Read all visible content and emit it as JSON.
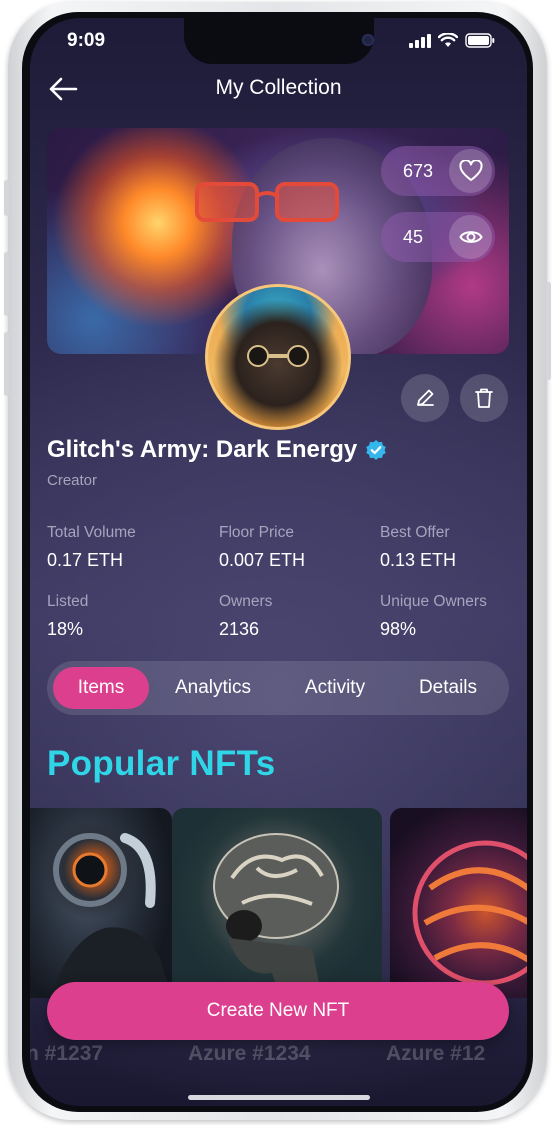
{
  "status_bar": {
    "time": "9:09"
  },
  "header": {
    "title": "My Collection"
  },
  "banner": {
    "likes": "673",
    "views": "45"
  },
  "collection": {
    "name": "Glitch's Army: Dark Energy",
    "role": "Creator",
    "verified": true
  },
  "stats": [
    {
      "label": "Total Volume",
      "value": "0.17 ETH"
    },
    {
      "label": "Floor Price",
      "value": "0.007 ETH"
    },
    {
      "label": "Best Offer",
      "value": "0.13 ETH"
    },
    {
      "label": "Listed",
      "value": "18%"
    },
    {
      "label": "Owners",
      "value": "2136"
    },
    {
      "label": "Unique Owners",
      "value": "98%"
    }
  ],
  "tabs": [
    {
      "label": "Items",
      "active": true
    },
    {
      "label": "Analytics",
      "active": false
    },
    {
      "label": "Activity",
      "active": false
    },
    {
      "label": "Details",
      "active": false
    }
  ],
  "section_title": "Popular NFTs",
  "nft_cards": [
    {
      "label": "n #1237"
    },
    {
      "label": "Azure #1234"
    },
    {
      "label": "Azure #12"
    }
  ],
  "actions": {
    "create_label": "Create New NFT"
  },
  "colors": {
    "accent_pink": "#dd3f8f",
    "accent_cyan": "#2fd6e8",
    "background": "#2f2b4f"
  },
  "icons": [
    "back-arrow-icon",
    "heart-icon",
    "eye-icon",
    "pencil-icon",
    "trash-icon",
    "verified-badge-icon",
    "signal-icon",
    "wifi-icon",
    "battery-icon"
  ]
}
